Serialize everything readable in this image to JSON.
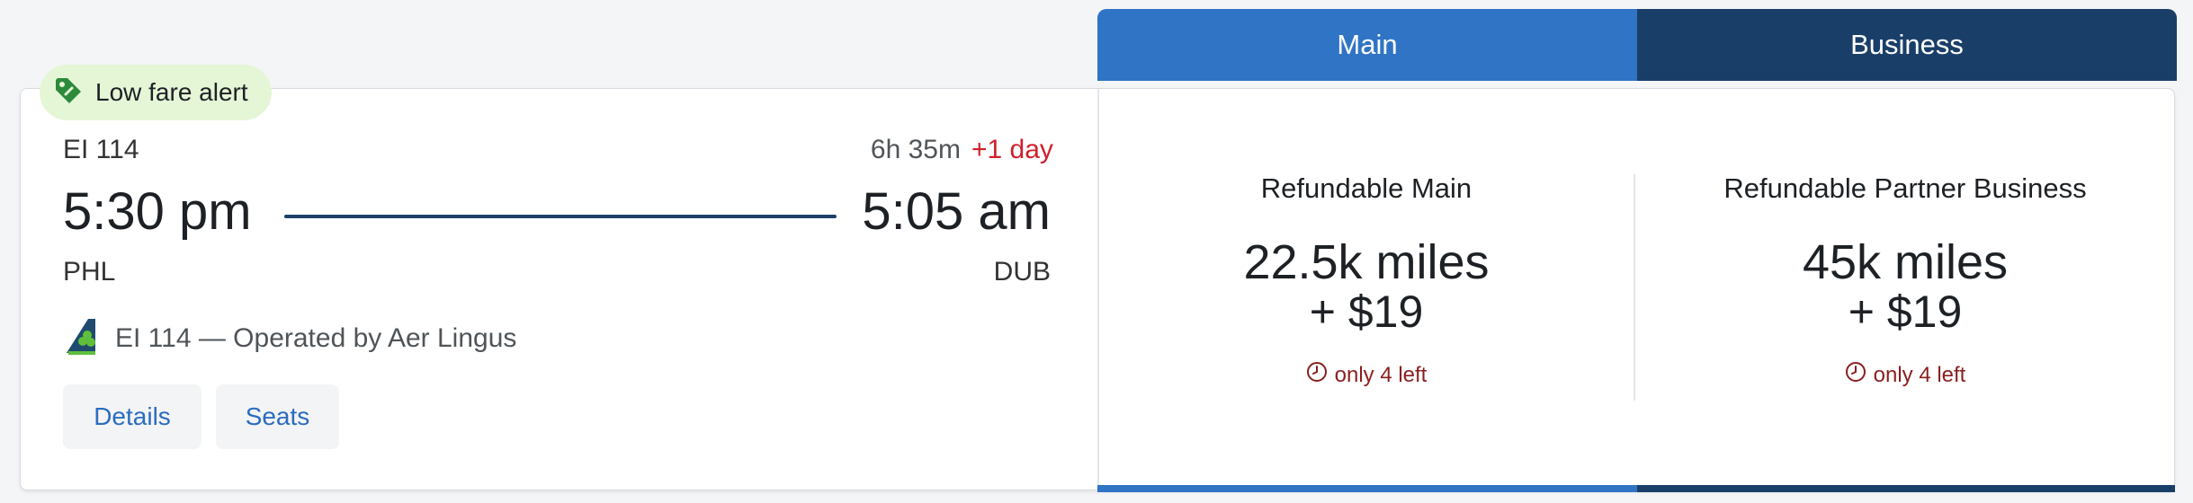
{
  "cabins": {
    "main_label": "Main",
    "business_label": "Business"
  },
  "badge": {
    "label": "Low fare alert",
    "icon": "tag-icon",
    "color": "#e5f6d6"
  },
  "flight": {
    "number": "EI 114",
    "duration": "6h 35m",
    "day_offset": "+1 day",
    "departure_time": "5:30 pm",
    "arrival_time": "5:05 am",
    "origin": "PHL",
    "destination": "DUB",
    "operated_by": "EI 114 — Operated by Aer Lingus",
    "airline_icon": "aer-lingus-logo-icon"
  },
  "actions": {
    "details_label": "Details",
    "seats_label": "Seats"
  },
  "fares": [
    {
      "name": "Refundable Main",
      "miles": "22.5k miles",
      "tax": "+ $19",
      "seats_left": "only 4 left"
    },
    {
      "name": "Refundable Partner Business",
      "miles": "45k miles",
      "tax": "+ $19",
      "seats_left": "only 4 left"
    }
  ],
  "colors": {
    "main_tab": "#2f74c5",
    "business_tab": "#193f69",
    "alert_red": "#d0202c",
    "link_blue": "#2b6cbf"
  }
}
